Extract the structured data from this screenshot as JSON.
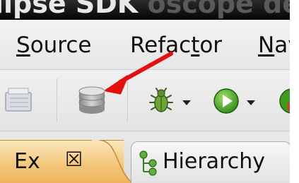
{
  "title_bar": {
    "text_bright": "lipse SDK",
    "text_dim": " oscope de P"
  },
  "menu": {
    "items": [
      {
        "pre": "",
        "u": "S",
        "post": "ource"
      },
      {
        "pre": "",
        "u": "R",
        "post": "efac"
      },
      {
        "pre": "",
        "u": "t",
        "post": "or"
      },
      {
        "pre": "",
        "u": "N",
        "post": "av"
      }
    ]
  },
  "toolbar": {
    "icons": [
      "open-icon",
      "database-icon",
      "debug-bug-icon",
      "run-play-icon",
      "run-external-icon"
    ],
    "annotation_color": "#e41010"
  },
  "tabs": {
    "active_label": "Ex",
    "active_close": "☒",
    "hierarchy_label": "Hierarchy",
    "accent": "#f4c77c"
  }
}
